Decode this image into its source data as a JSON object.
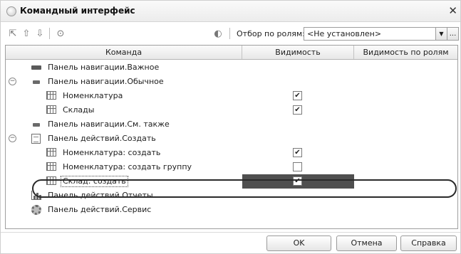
{
  "window": {
    "title": "Командный интерфейс"
  },
  "toolbar": {
    "filter_label": "Отбор по ролям:",
    "filter_value": "<Не установлен>",
    "more_label": "..."
  },
  "grid": {
    "columns": [
      "Команда",
      "Видимость",
      "Видимость по ролям"
    ],
    "rows": [
      {
        "label": "Панель навигации.Важное",
        "icon": "navigation-panel-icon",
        "checked": null
      },
      {
        "label": "Панель навигации.Обычное",
        "icon": "navigation-panel-icon",
        "checked": null,
        "expanded": true
      },
      {
        "label": "Номенклатура",
        "icon": "table-icon",
        "checked": true
      },
      {
        "label": "Склады",
        "icon": "table-icon",
        "checked": true
      },
      {
        "label": "Панель навигации.См. также",
        "icon": "navigation-panel-icon",
        "checked": null
      },
      {
        "label": "Панель действий.Создать",
        "icon": "document-icon",
        "checked": null,
        "expanded": true
      },
      {
        "label": "Номенклатура: создать",
        "icon": "table-icon",
        "checked": true
      },
      {
        "label": "Номенклатура: создать группу",
        "icon": "table-icon",
        "checked": false
      },
      {
        "label": "Склад: создать",
        "icon": "table-icon",
        "checked": true,
        "selected": true
      },
      {
        "label": "Панель действий.Отчеты",
        "icon": "reports-chart-icon",
        "checked": null
      },
      {
        "label": "Панель действий.Сервис",
        "icon": "service-gear-icon",
        "checked": null
      }
    ]
  },
  "buttons": {
    "ok": "OK",
    "cancel": "Отмена",
    "help": "Справка"
  },
  "colors": {
    "selected_cell": "#4f4f4f",
    "highlight_oval": "#2a2a2a"
  }
}
